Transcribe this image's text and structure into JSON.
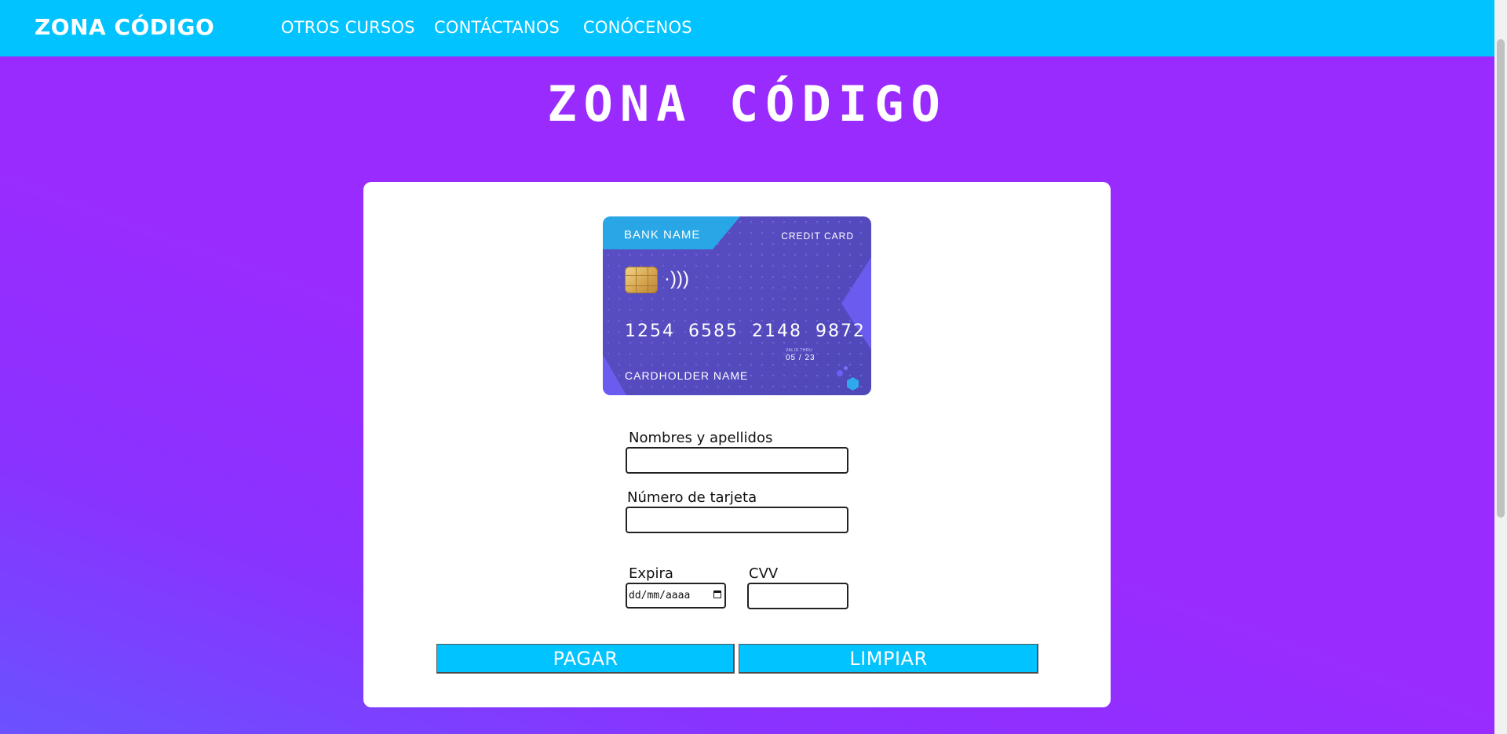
{
  "navbar": {
    "brand": "ZONA CÓDIGO",
    "links": [
      "OTROS CURSOS",
      "CONTÁCTANOS",
      "CONÓCENOS"
    ]
  },
  "hero": {
    "title": "ZONA CÓDIGO"
  },
  "credit_card": {
    "bank_name": "BANK NAME",
    "card_type": "CREDIT CARD",
    "number": "1254 6585 2148 9872",
    "valid_thru_label": "VALID THRU",
    "expiry": "05 / 23",
    "holder": "CARDHOLDER NAME"
  },
  "form": {
    "name_label": "Nombres y apellidos",
    "name_value": "",
    "card_number_label": "Número de tarjeta",
    "card_number_value": "",
    "expiry_label": "Expira",
    "expiry_placeholder": "dd/mm/aaaa",
    "cvv_label": "CVV",
    "cvv_value": ""
  },
  "buttons": {
    "pay": "PAGAR",
    "clear": "LIMPIAR"
  },
  "colors": {
    "navbar": "#00c3ff",
    "background": "#9a2bff",
    "panel": "#ffffff",
    "button": "#00c3ff"
  }
}
